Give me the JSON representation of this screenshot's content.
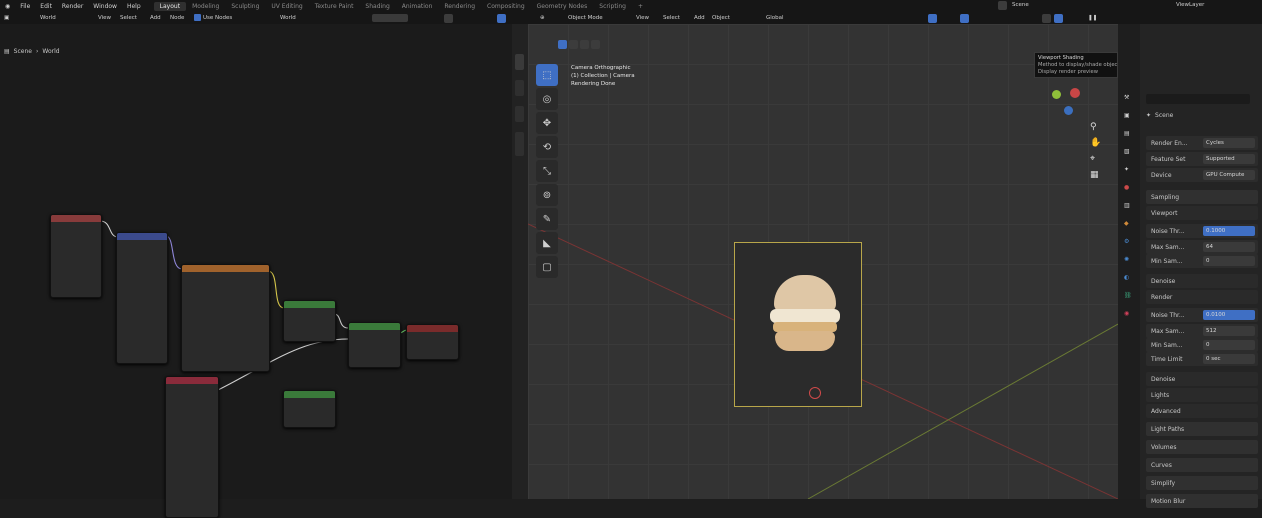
{
  "menu": {
    "items": [
      "File",
      "Edit",
      "Render",
      "Window",
      "Help"
    ]
  },
  "workspaces": [
    {
      "label": "Layout",
      "active": true
    },
    {
      "label": "Modeling"
    },
    {
      "label": "Sculpting"
    },
    {
      "label": "UV Editing"
    },
    {
      "label": "Texture Paint"
    },
    {
      "label": "Shading"
    },
    {
      "label": "Animation"
    },
    {
      "label": "Rendering"
    },
    {
      "label": "Compositing"
    },
    {
      "label": "Geometry Nodes"
    },
    {
      "label": "Scripting"
    }
  ],
  "scene_selector": "Scene",
  "view_layer": "ViewLayer",
  "node_editor": {
    "editor_label": "World",
    "menu": [
      "View",
      "Select",
      "Add",
      "Node"
    ],
    "use_nodes_label": "Use Nodes",
    "world_name": "World",
    "breadcrumb": [
      "Scene",
      "World"
    ]
  },
  "viewport": {
    "mode": "Object Mode",
    "menu": [
      "View",
      "Select",
      "Add",
      "Object"
    ],
    "transform": "Global",
    "overlay_lines": [
      "Camera Orthographic",
      "(1) Collection | Camera",
      "Rendering Done"
    ]
  },
  "tooltip": {
    "title": "Viewport Shading",
    "line1": "Method to display/shade objects in the 3D View",
    "line2": "Display render preview"
  },
  "properties": {
    "scene_label": "Scene",
    "rows": [
      {
        "label": "Render En...",
        "value": "Cycles"
      },
      {
        "label": "Feature Set",
        "value": "Supported"
      },
      {
        "label": "Device",
        "value": "GPU Compute"
      }
    ],
    "sampling_label": "Sampling",
    "viewport_label": "Viewport",
    "noise_threshold_label": "Noise Thr...",
    "viewport_threshold": "0.1000",
    "max_samples_label": "Max Sam...",
    "viewport_max": "64",
    "min_samples_label": "Min Sam...",
    "viewport_min": "0",
    "denoise_label": "Denoise",
    "render_label": "Render",
    "render_threshold": "0.0100",
    "render_max": "512",
    "render_min": "0",
    "time_limit_label": "Time Limit",
    "time_limit": "0 sec",
    "sections": [
      "Denoise",
      "Lights",
      "Advanced",
      "Light Paths",
      "Volumes",
      "Curves",
      "Simplify",
      "Motion Blur"
    ]
  }
}
